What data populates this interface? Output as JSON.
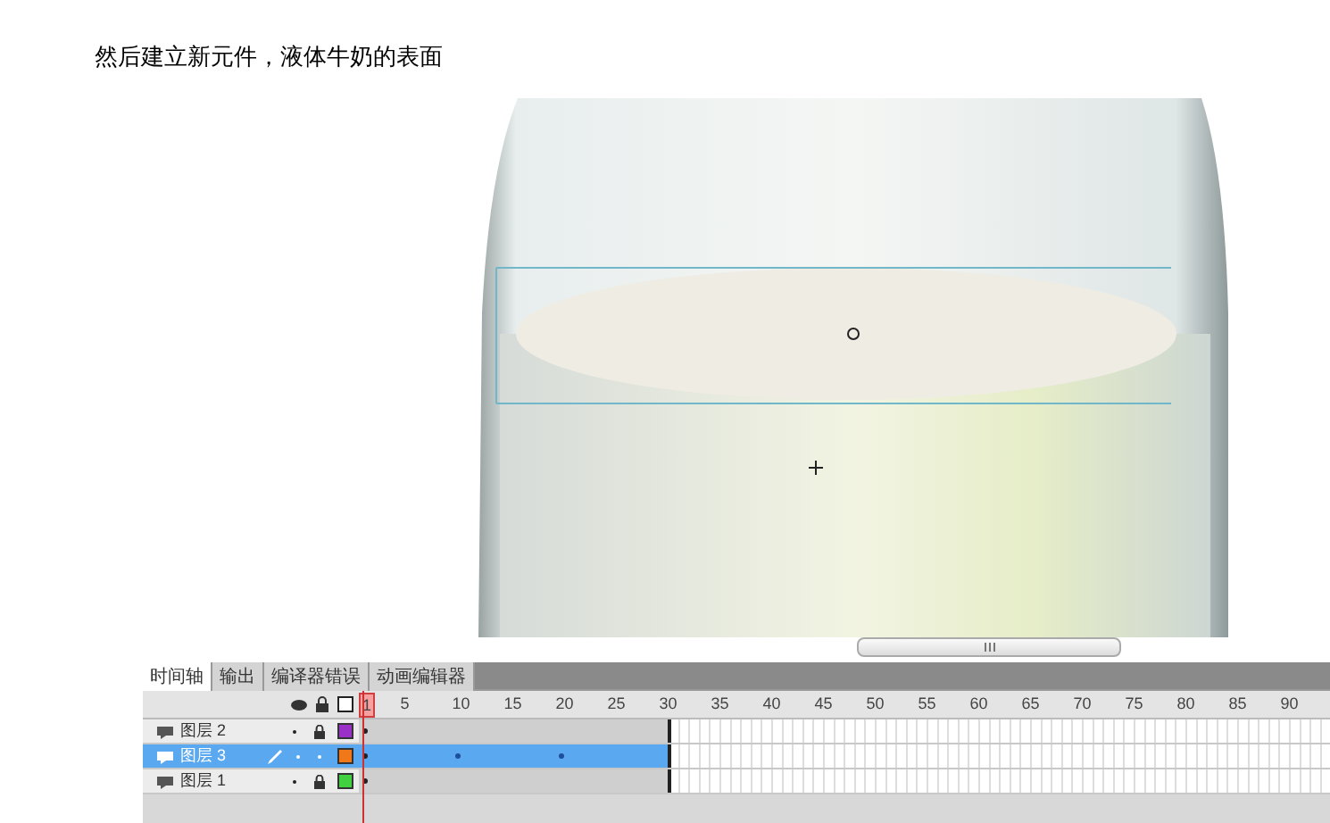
{
  "heading": "然后建立新元件，液体牛奶的表面",
  "timeline": {
    "tabs": [
      {
        "label": "时间轴",
        "selected": true
      },
      {
        "label": "输出",
        "selected": false
      },
      {
        "label": "编译器错误",
        "selected": false
      },
      {
        "label": "动画编辑器",
        "selected": false
      }
    ],
    "frame_numbers": [
      "1",
      "5",
      "10",
      "15",
      "20",
      "25",
      "30",
      "35",
      "40",
      "45",
      "50",
      "55",
      "60",
      "65",
      "70",
      "75",
      "80",
      "85",
      "90"
    ],
    "layers": [
      {
        "name": "图层 2",
        "selected": false,
        "locked": true,
        "color": "#9b30c8",
        "tween": false
      },
      {
        "name": "图层 3",
        "selected": true,
        "locked": false,
        "color": "#f07818",
        "tween": true
      },
      {
        "name": "图层 1",
        "selected": false,
        "locked": true,
        "color": "#40d040",
        "tween": false
      }
    ]
  }
}
